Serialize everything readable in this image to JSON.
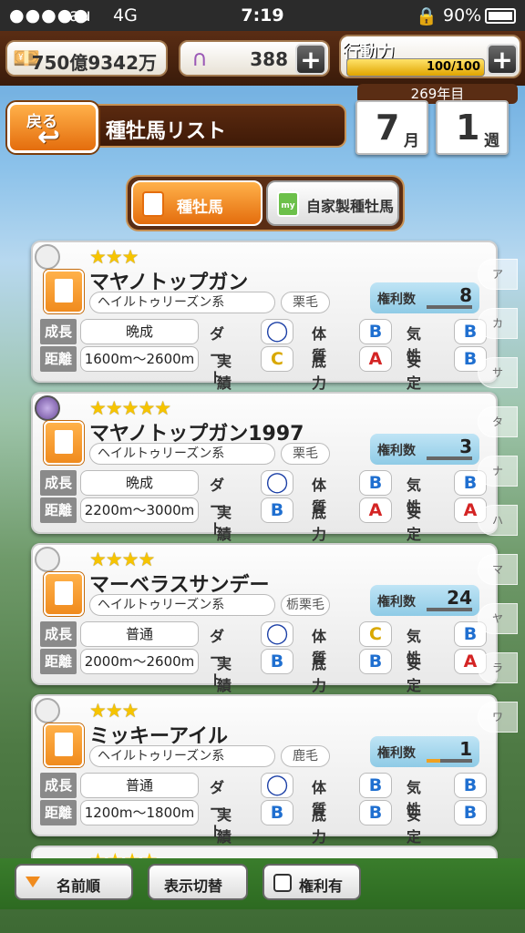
{
  "status_bar": {
    "signal": "●●●●●",
    "carrier": "au",
    "network": "4G",
    "time": "7:19",
    "battery": "90%"
  },
  "resources": {
    "money": "750億9342万",
    "horseshoes": "388",
    "action_label": "行動力",
    "action_value": "100/100",
    "action_fill_fraction": 1.0
  },
  "header": {
    "back_label": "戻る",
    "title": "種牡馬リスト",
    "year": "269年目",
    "month_num": "7",
    "month_unit": "月",
    "week_num": "1",
    "week_unit": "週"
  },
  "tabs": [
    {
      "label": "種牡馬",
      "icon_text": ""
    },
    {
      "label": "自家製種牡馬",
      "icon_text": "my"
    }
  ],
  "labels": {
    "growth": "成長",
    "distance": "距離",
    "dirt": "ダート",
    "record": "実績",
    "physique": "体質",
    "stamina": "底力",
    "temper": "気性",
    "stability": "安定",
    "rights": "権利数"
  },
  "horses": [
    {
      "stars": "★★★",
      "name": "マヤノトップガン",
      "line": "ヘイルトゥリーズン系",
      "coat": "栗毛",
      "rights": "8",
      "rights_fraction": 0.0,
      "growth": "晩成",
      "distance": "1600m〜2600m",
      "dirt": "O",
      "record": "C",
      "physique": "B",
      "stamina": "A",
      "temper": "B",
      "stability": "B"
    },
    {
      "stars": "★★★★★",
      "name": "マヤノトップガン1997",
      "line": "ヘイルトゥリーズン系",
      "coat": "栗毛",
      "rights": "3",
      "rights_fraction": 0.0,
      "growth": "晩成",
      "distance": "2200m〜3000m",
      "dirt": "O",
      "record": "B",
      "physique": "B",
      "stamina": "A",
      "temper": "B",
      "stability": "A"
    },
    {
      "stars": "★★★★",
      "name": "マーベラスサンデー",
      "line": "ヘイルトゥリーズン系",
      "coat": "栃栗毛",
      "rights": "24",
      "rights_fraction": 0.0,
      "growth": "普通",
      "distance": "2000m〜2600m",
      "dirt": "O",
      "record": "B",
      "physique": "C",
      "stamina": "B",
      "temper": "B",
      "stability": "A"
    },
    {
      "stars": "★★★",
      "name": "ミッキーアイル",
      "line": "ヘイルトゥリーズン系",
      "coat": "鹿毛",
      "rights": "1",
      "rights_fraction": 0.3,
      "growth": "普通",
      "distance": "1200m〜1800m",
      "dirt": "O",
      "record": "B",
      "physique": "B",
      "stamina": "B",
      "temper": "B",
      "stability": "B"
    }
  ],
  "partial_card_stars": "★★★★",
  "index": [
    "ア",
    "カ",
    "サ",
    "タ",
    "ナ",
    "ハ",
    "マ",
    "ヤ",
    "ラ",
    "ワ"
  ],
  "bottom": {
    "sort_label": "名前順",
    "toggle_label": "表示切替",
    "filter_label": "権利有"
  }
}
